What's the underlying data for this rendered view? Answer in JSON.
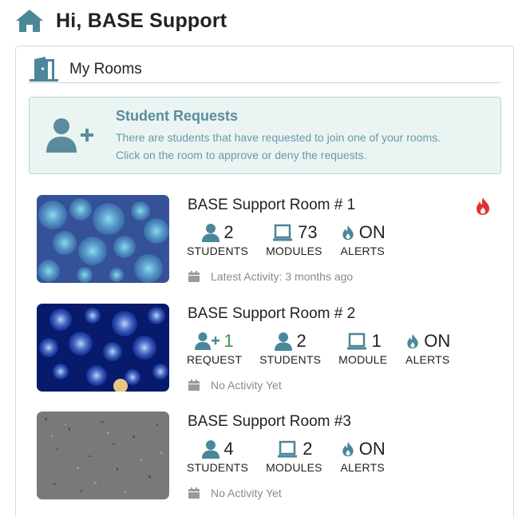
{
  "header": {
    "greeting": "Hi, BASE Support",
    "icon": "home-icon"
  },
  "card": {
    "title": "My Rooms",
    "icon": "door-icon"
  },
  "requests_alert": {
    "icon": "user-plus-icon",
    "title": "Student Requests",
    "line1": "There are students that have requested to join one of your rooms.",
    "line2": "Click on the room to approve or deny the requests."
  },
  "colors": {
    "accent": "#4a8799",
    "alert_bg": "#eaf4f3",
    "fire": "#e03030",
    "request_green": "#3a9a3a"
  },
  "rooms": [
    {
      "name": "BASE Support Room # 1",
      "hot": true,
      "students": {
        "value": "2",
        "label": "STUDENTS"
      },
      "modules": {
        "value": "73",
        "label": "MODULES"
      },
      "alerts": {
        "value": "ON",
        "label": "ALERTS"
      },
      "activity": "Latest Activity: 3 months ago"
    },
    {
      "name": "BASE Support Room # 2",
      "hot": false,
      "requests": {
        "value": "1",
        "label": "REQUEST"
      },
      "students": {
        "value": "2",
        "label": "STUDENTS"
      },
      "modules": {
        "value": "1",
        "label": "MODULE"
      },
      "alerts": {
        "value": "ON",
        "label": "ALERTS"
      },
      "activity": "No Activity Yet"
    },
    {
      "name": "BASE Support Room #3",
      "hot": false,
      "students": {
        "value": "4",
        "label": "STUDENTS"
      },
      "modules": {
        "value": "2",
        "label": "MODULES"
      },
      "alerts": {
        "value": "ON",
        "label": "ALERTS"
      },
      "activity": "No Activity Yet"
    }
  ]
}
